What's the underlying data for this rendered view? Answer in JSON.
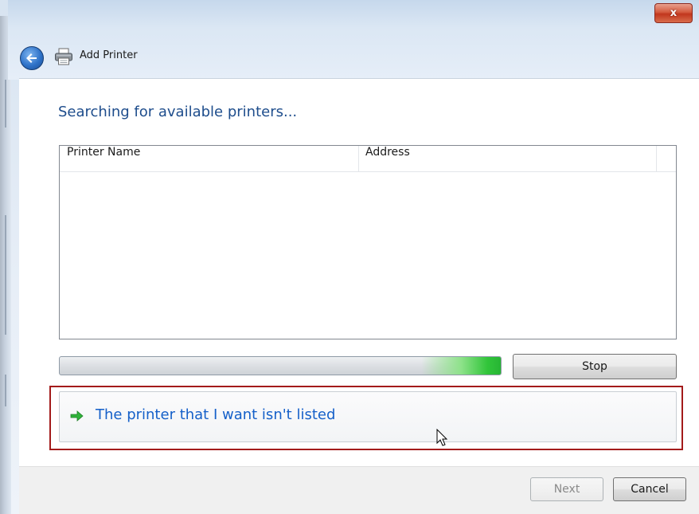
{
  "window": {
    "title": "Add Printer",
    "close_glyph": "x"
  },
  "main": {
    "heading": "Searching for available printers...",
    "columns": [
      "Printer Name",
      "Address"
    ],
    "rows": [],
    "progress_fraction": 1.0
  },
  "actions": {
    "stop_label": "Stop",
    "not_listed_link": "The printer that I want isn't listed"
  },
  "footer": {
    "next_label": "Next",
    "cancel_label": "Cancel"
  },
  "icons": {
    "back": "back-arrow-icon",
    "printer": "printer-icon",
    "link_arrow": "green-arrow-icon",
    "cursor": "mouse-cursor-icon"
  },
  "colors": {
    "heading": "#1e4d8c",
    "link": "#1560c9",
    "progress_green": "#31c53a",
    "highlight": "#a31b1b",
    "close_button": "#c1361d"
  }
}
